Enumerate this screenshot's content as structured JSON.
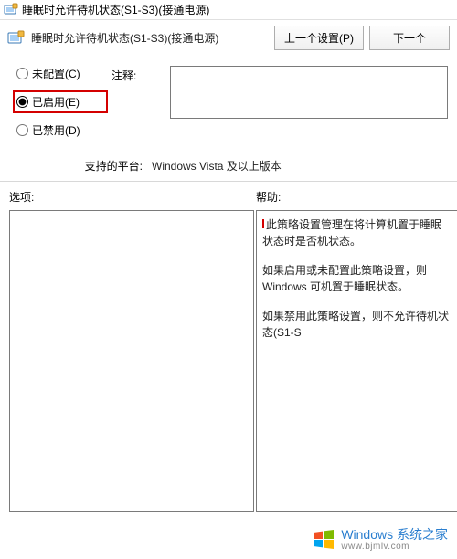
{
  "titlebar": {
    "text": "睡眠时允许待机状态(S1-S3)(接通电源)"
  },
  "header": {
    "title": "睡眠时允许待机状态(S1-S3)(接通电源)"
  },
  "nav": {
    "prev_label": "上一个设置(P)",
    "next_label": "下一个"
  },
  "radios": {
    "not_configured": "未配置(C)",
    "enabled": "已启用(E)",
    "disabled": "已禁用(D)",
    "comment_label": "注释:",
    "comment_value": ""
  },
  "platform": {
    "label": "支持的平台:",
    "value": "Windows Vista 及以上版本"
  },
  "lower_labels": {
    "options": "选项:",
    "help": "帮助:"
  },
  "help": {
    "p1": "此策略设置管理在将计算机置于睡眠状态时是否",
    "p2_a": "机状态。",
    "p3": "如果启用或未配置此策略设置，则 Windows 可",
    "p4": "机置于睡眠状态。",
    "p5": "如果禁用此策略设置，则不允许待机状态(S1-S"
  },
  "watermark": {
    "primary": "Windows 系统之家",
    "secondary": "www.bjmlv.com"
  }
}
